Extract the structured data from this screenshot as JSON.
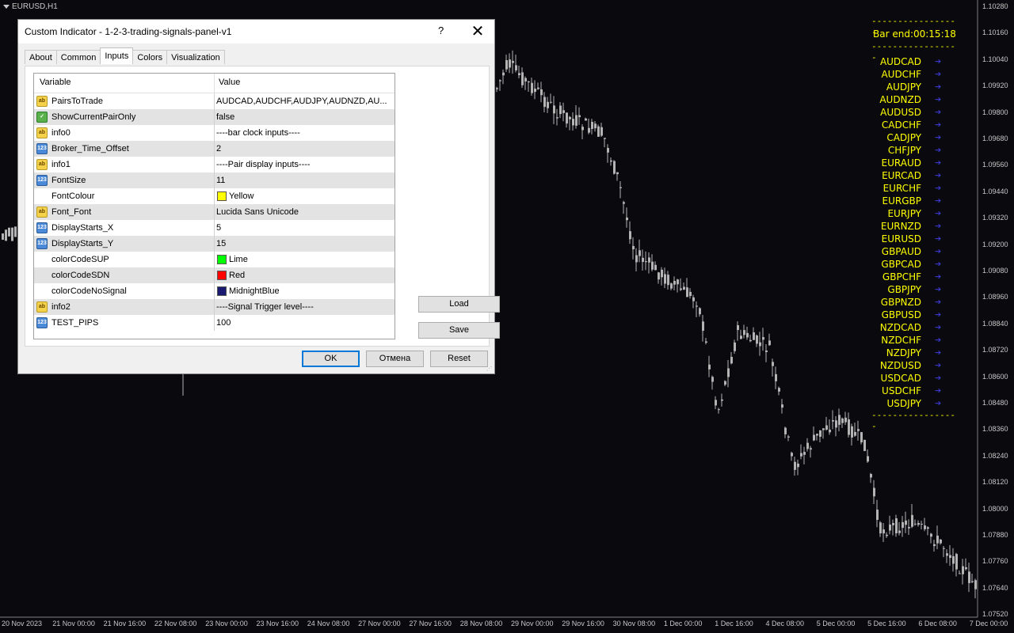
{
  "chart": {
    "symbol": "EURUSD,H1",
    "price_ticks": [
      "1.10280",
      "1.10160",
      "1.10040",
      "1.09920",
      "1.09800",
      "1.09680",
      "1.09560",
      "1.09440",
      "1.09320",
      "1.09200",
      "1.09080",
      "1.08960",
      "1.08840",
      "1.08720",
      "1.08600",
      "1.08480",
      "1.08360",
      "1.08240",
      "1.08120",
      "1.08000",
      "1.07880",
      "1.07760",
      "1.07640",
      "1.07520"
    ],
    "time_ticks": [
      "20 Nov 2023",
      "21 Nov 00:00",
      "21 Nov 16:00",
      "22 Nov 08:00",
      "23 Nov 00:00",
      "23 Nov 16:00",
      "24 Nov 08:00",
      "27 Nov 00:00",
      "27 Nov 16:00",
      "28 Nov 08:00",
      "29 Nov 00:00",
      "29 Nov 16:00",
      "30 Nov 08:00",
      "1 Dec 00:00",
      "1 Dec 16:00",
      "4 Dec 08:00",
      "5 Dec 00:00",
      "5 Dec 16:00",
      "6 Dec 08:00",
      "7 Dec 00:00"
    ],
    "price_range": [
      1.0752,
      1.1028
    ],
    "colors": {
      "background": "#0a0a0e",
      "candles": "#b4b4b4",
      "axis_text": "#c8c8c8"
    }
  },
  "signals_panel": {
    "separator": "-----------------",
    "bar_end": "Bar end:00:15:18",
    "pairs": [
      "AUDCAD",
      "AUDCHF",
      "AUDJPY",
      "AUDNZD",
      "AUDUSD",
      "CADCHF",
      "CADJPY",
      "CHFJPY",
      "EURAUD",
      "EURCAD",
      "EURCHF",
      "EURGBP",
      "EURJPY",
      "EURNZD",
      "EURUSD",
      "GBPAUD",
      "GBPCAD",
      "GBPCHF",
      "GBPJPY",
      "GBPNZD",
      "GBPUSD",
      "NZDCAD",
      "NZDCHF",
      "NZDJPY",
      "NZDUSD",
      "USDCAD",
      "USDCHF",
      "USDJPY"
    ],
    "arrow_glyph": "➔",
    "text_color": "#ffff00",
    "arrow_color": "#3838c8"
  },
  "dialog": {
    "title": "Custom Indicator - 1-2-3-trading-signals-panel-v1",
    "help": "?",
    "close": "✕",
    "tabs": [
      "About",
      "Common",
      "Inputs",
      "Colors",
      "Visualization"
    ],
    "active_tab": "Inputs",
    "columns": [
      "Variable",
      "Value"
    ],
    "rows": [
      {
        "type": "str",
        "variable": "PairsToTrade",
        "value": "AUDCAD,AUDCHF,AUDJPY,AUDNZD,AU..."
      },
      {
        "type": "bool",
        "variable": "ShowCurrentPairOnly",
        "value": "false"
      },
      {
        "type": "str",
        "variable": "info0",
        "value": "----bar clock inputs----"
      },
      {
        "type": "int",
        "variable": "Broker_Time_Offset",
        "value": "2"
      },
      {
        "type": "str",
        "variable": "info1",
        "value": "----Pair display inputs----"
      },
      {
        "type": "int",
        "variable": "FontSize",
        "value": "11"
      },
      {
        "type": "color",
        "variable": "FontColour",
        "value": "Yellow",
        "swatch": "#ffff00"
      },
      {
        "type": "str",
        "variable": "Font_Font",
        "value": "Lucida Sans Unicode"
      },
      {
        "type": "int",
        "variable": "DisplayStarts_X",
        "value": "5"
      },
      {
        "type": "int",
        "variable": "DisplayStarts_Y",
        "value": "15"
      },
      {
        "type": "color",
        "variable": "colorCodeSUP",
        "value": "Lime",
        "swatch": "#00ff00"
      },
      {
        "type": "color",
        "variable": "colorCodeSDN",
        "value": "Red",
        "swatch": "#ff0000"
      },
      {
        "type": "color",
        "variable": "colorCodeNoSignal",
        "value": "MidnightBlue",
        "swatch": "#191970"
      },
      {
        "type": "str",
        "variable": "info2",
        "value": "----Signal Trigger level----"
      },
      {
        "type": "int",
        "variable": "TEST_PIPS",
        "value": "100"
      }
    ],
    "icon_labels": {
      "str": "ab",
      "int": "123",
      "bool": "✓",
      "color": ""
    },
    "load_label": "Load",
    "save_label": "Save",
    "ok_label": "OK",
    "cancel_label": "Отмена",
    "reset_label": "Reset"
  }
}
